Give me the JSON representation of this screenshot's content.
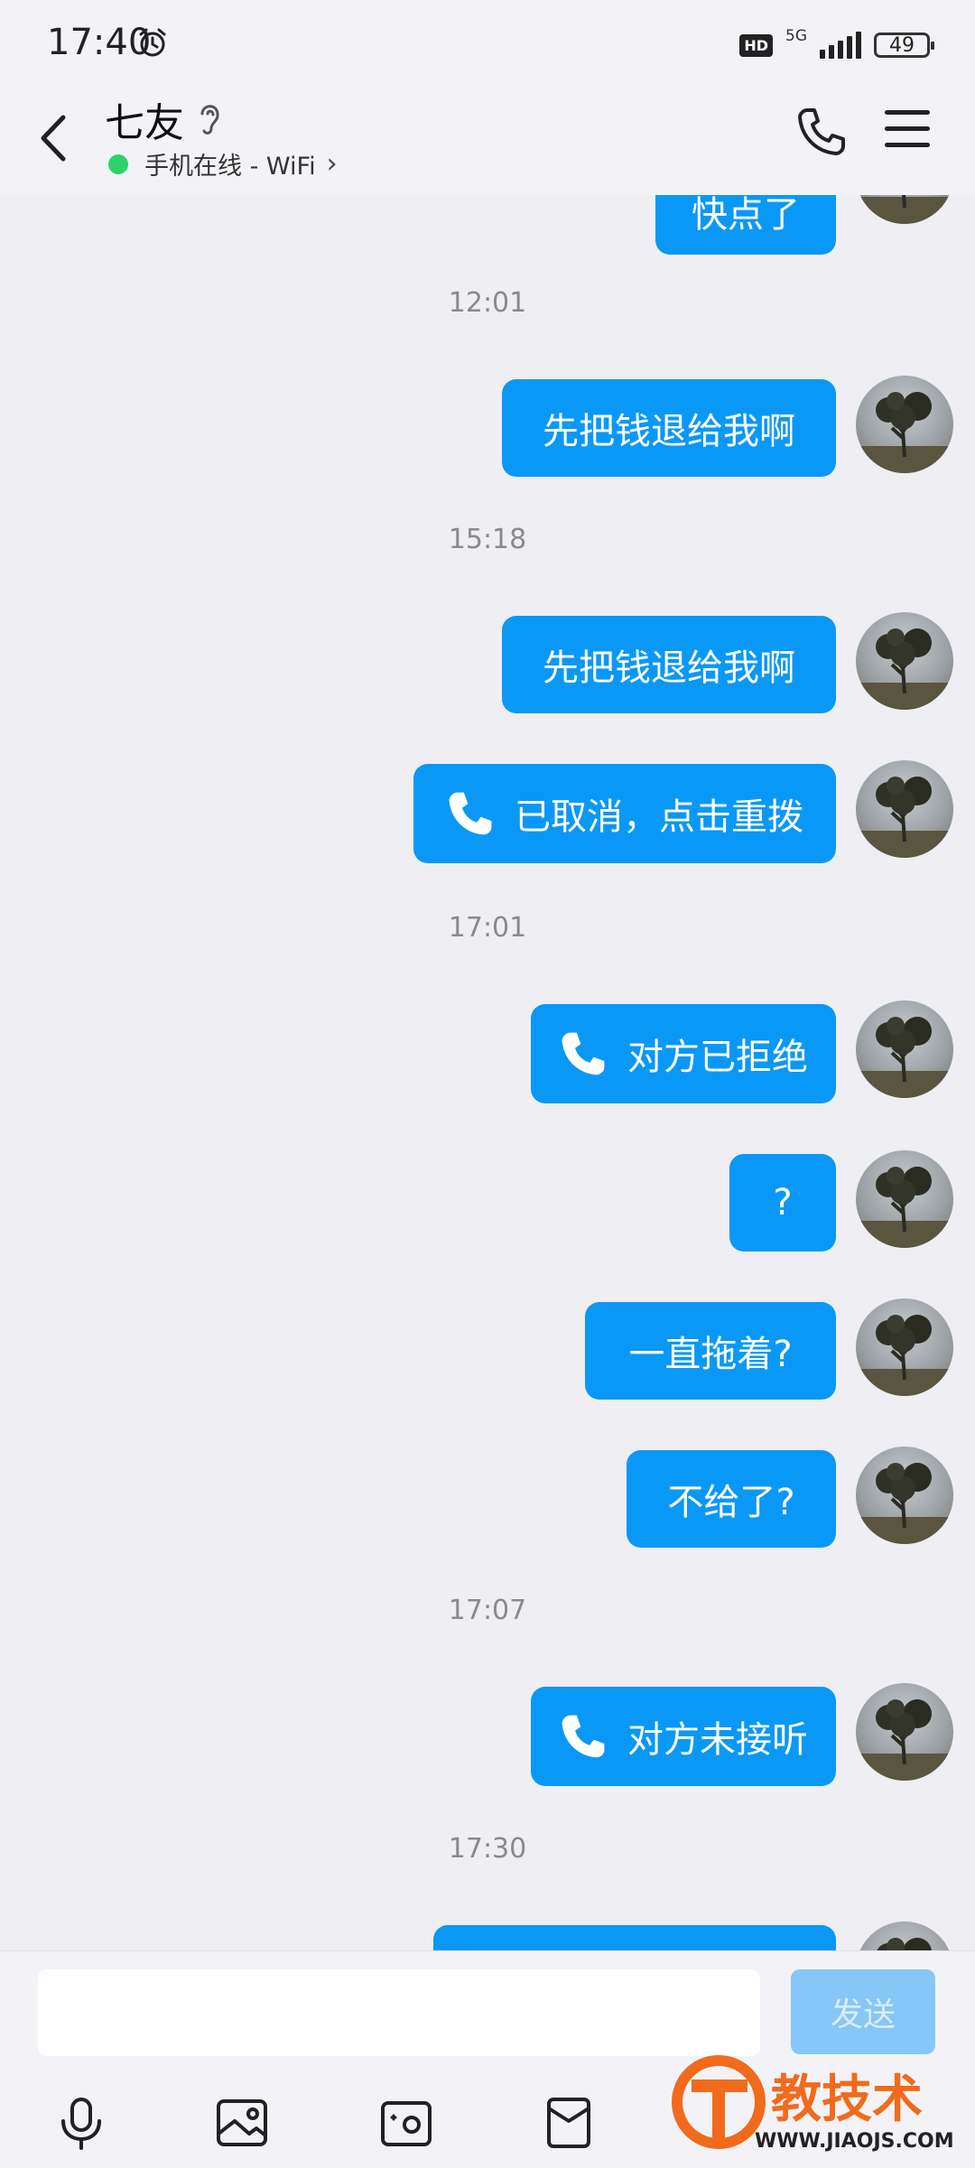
{
  "status_bar": {
    "time": "17:40",
    "hd": "HD",
    "network": "5G",
    "battery": "49",
    "icons": [
      "alarm-icon",
      "hd-icon",
      "signal-icon",
      "battery-icon"
    ]
  },
  "header": {
    "title": "七友",
    "status_text": "手机在线 - WiFi",
    "status_color": "#2bd36a",
    "icons": [
      "back-icon",
      "ear-icon",
      "phone-call-icon",
      "menu-icon"
    ]
  },
  "chat": {
    "bubble_color": "#0a98f7",
    "partial_top_message": "快点了",
    "items": [
      {
        "type": "time",
        "text": "12:01"
      },
      {
        "type": "msg",
        "text": "先把钱退给我啊"
      },
      {
        "type": "time",
        "text": "15:18"
      },
      {
        "type": "msg",
        "text": "先把钱退给我啊"
      },
      {
        "type": "call",
        "text": "已取消，点击重拨"
      },
      {
        "type": "time",
        "text": "17:01"
      },
      {
        "type": "call",
        "text": "对方已拒绝"
      },
      {
        "type": "msg",
        "text": "?"
      },
      {
        "type": "msg",
        "text": "一直拖着?"
      },
      {
        "type": "msg",
        "text": "不给了?"
      },
      {
        "type": "time",
        "text": "17:07"
      },
      {
        "type": "call",
        "text": "对方未接听"
      },
      {
        "type": "time",
        "text": "17:30"
      }
    ]
  },
  "input_bar": {
    "text_value": "",
    "send_label": "发送",
    "tools": [
      "microphone-icon",
      "image-icon",
      "camera-icon",
      "red-packet-icon"
    ]
  },
  "watermark": {
    "brand": "教技术",
    "url": "WWW.JIAOJS.COM"
  }
}
